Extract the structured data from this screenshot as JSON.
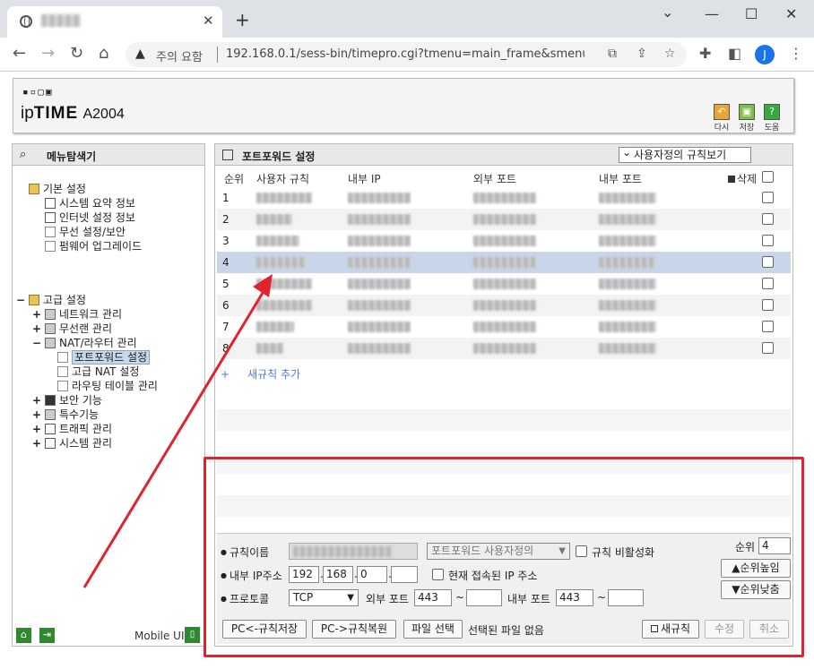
{
  "browser": {
    "tab_close": "✕",
    "tab_new": "+",
    "window": {
      "minimize": "—",
      "maximize": "☐",
      "close": "✕",
      "chevron": "⌄"
    },
    "security_warning": "주의 요함",
    "url": "192.168.0.1/sess-bin/timepro.cgi?tmenu=main_frame&smenu=...",
    "avatar_letter": "J"
  },
  "header": {
    "logo_dots": "▪︎▫︎▢▣",
    "logo_ip": "ip",
    "logo_time": "TIME",
    "model": "A2004",
    "buttons": [
      {
        "label": "다시",
        "color": "#e8a531"
      },
      {
        "label": "저장",
        "color": "#7cc043"
      },
      {
        "label": "도움",
        "color": "#38a845"
      }
    ]
  },
  "sidebar": {
    "title": "메뉴탐색기",
    "basic": {
      "title": "기본 설정",
      "items": [
        "시스템 요약 정보",
        "인터넷 설정 정보",
        "무선 설정/보안",
        "펌웨어 업그레이드"
      ]
    },
    "advanced": {
      "title": "고급 설정",
      "items": [
        {
          "label": "네트워크 관리",
          "pm": "+"
        },
        {
          "label": "무선랜 관리",
          "pm": "+"
        },
        {
          "label": "NAT/라우터 관리",
          "pm": "−"
        },
        {
          "label": "보안 기능",
          "pm": "+"
        },
        {
          "label": "특수기능",
          "pm": "+"
        },
        {
          "label": "트래픽 관리",
          "pm": "+"
        },
        {
          "label": "시스템 관리",
          "pm": "+"
        }
      ],
      "nat_children": [
        "포트포워드 설정",
        "고급 NAT 설정",
        "라우팅 테이블 관리"
      ],
      "root_pm": "−"
    },
    "mobile_ui": "Mobile UI"
  },
  "main": {
    "title": "포트포워드 설정",
    "view_select": "사용자정의 규칙보기",
    "columns": {
      "rank": "순위",
      "rule": "사용자 규칙",
      "internal_ip": "내부 IP",
      "external_port": "외부 포트",
      "internal_port": "내부 포트",
      "delete": "삭제"
    },
    "rows": [
      {
        "rank": "1"
      },
      {
        "rank": "2"
      },
      {
        "rank": "3"
      },
      {
        "rank": "4"
      },
      {
        "rank": "5"
      },
      {
        "rank": "6"
      },
      {
        "rank": "7"
      },
      {
        "rank": "8"
      }
    ],
    "add_rule": "새규칙 추가",
    "add_plus": "+"
  },
  "form": {
    "rule_name_label": "규칙이름",
    "rule_type": "포트포워드 사용자정의",
    "disable_label": "규칙 비활성화",
    "internal_ip_label": "내부 IP주소",
    "ip": [
      "192",
      "168",
      "0",
      ""
    ],
    "current_ip_label": "현재 접속된 IP 주소",
    "protocol_label": "프로토콜",
    "protocol": "TCP",
    "ext_port_label": "외부 포트",
    "ext_port_from": "443",
    "ext_port_to": "",
    "int_port_label": "내부 포트",
    "int_port_from": "443",
    "int_port_to": "",
    "tilde": "~",
    "rank_label": "순위",
    "rank_value": "4",
    "rank_up": "▲순위높임",
    "rank_down": "▼순위낮춤",
    "save_rules": "PC<-규칙저장",
    "restore_rules": "PC->규칙복원",
    "file_select": "파일 선택",
    "no_file": "선택된 파일 없음",
    "new_rule": "새규칙",
    "modify": "수정",
    "cancel": "취소"
  },
  "annotation_color": "#e0242e"
}
